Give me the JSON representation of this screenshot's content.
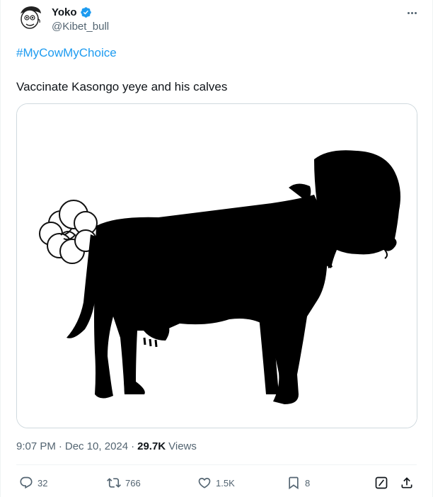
{
  "author": {
    "display_name": "Yoko",
    "handle": "@Kibet_bull",
    "verified": true,
    "avatar_icon": "cartoon-face-avatar"
  },
  "tweet": {
    "hashtag": "#MyCowMyChoice",
    "text": "Vaccinate Kasongo yeye and his calves",
    "image_icon": "cow-silhouette-with-human-head"
  },
  "meta": {
    "time": "9:07 PM",
    "separator": "·",
    "date": "Dec 10, 2024",
    "views_count": "29.7K",
    "views_label": "Views"
  },
  "actions": {
    "replies": "32",
    "reposts": "766",
    "likes": "1.5K",
    "bookmarks": "8"
  },
  "colors": {
    "accent": "#1d9bf0",
    "text": "#0f1419",
    "secondary": "#536471",
    "border": "#cfd9de"
  }
}
